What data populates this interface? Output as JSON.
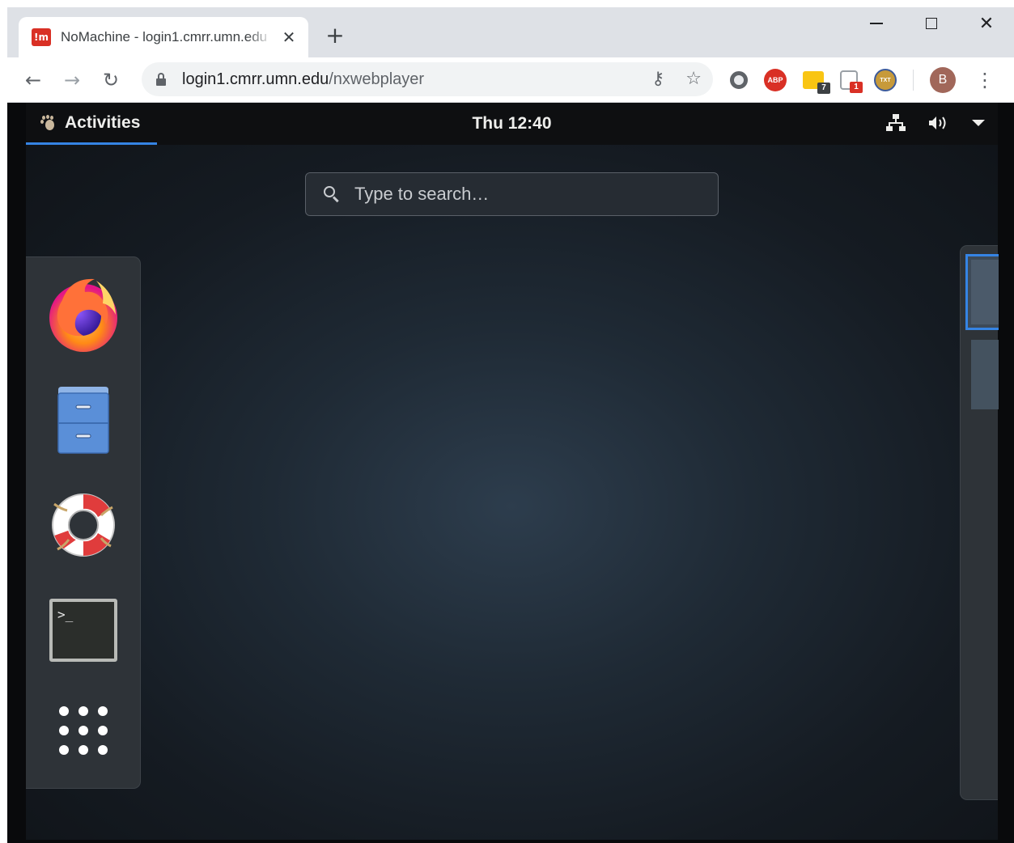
{
  "browser": {
    "tab": {
      "favicon_text": "!m",
      "title": "NoMachine - login1.cmrr.umn.edu",
      "close_glyph": "✕"
    },
    "new_tab_glyph": "+",
    "window_controls": {
      "close_glyph": "✕"
    },
    "nav": {
      "back_glyph": "←",
      "forward_glyph": "→",
      "reload_glyph": "↻"
    },
    "omnibox": {
      "host": "login1.cmrr.umn.edu",
      "path": "/nxwebplayer",
      "key_glyph": "⚷",
      "star_glyph": "☆"
    },
    "extensions": [
      {
        "name": "circle-extension",
        "badge": ""
      },
      {
        "name": "adblock-plus",
        "label": "ABP",
        "badge": ""
      },
      {
        "name": "notes-extension",
        "badge": "7"
      },
      {
        "name": "shield-extension",
        "badge": "1"
      },
      {
        "name": "txt-extension",
        "label": "TXT",
        "badge": ""
      }
    ],
    "profile_initial": "B",
    "menu_glyph": "⋮",
    "colors": {
      "badge_dark": "#3c4043",
      "badge_red": "#d93025",
      "accent": "#3584e4"
    }
  },
  "gnome": {
    "activities_label": "Activities",
    "clock": "Thu 12:40",
    "search": {
      "placeholder": "Type to search…"
    },
    "dash_items": [
      {
        "icon": "firefox-icon",
        "name": "Firefox"
      },
      {
        "icon": "files-icon",
        "name": "Files"
      },
      {
        "icon": "help-icon",
        "name": "Help"
      },
      {
        "icon": "terminal-icon",
        "name": "Terminal"
      },
      {
        "icon": "app-grid-icon",
        "name": "Show Applications"
      }
    ],
    "terminal_prompt": ">_"
  }
}
